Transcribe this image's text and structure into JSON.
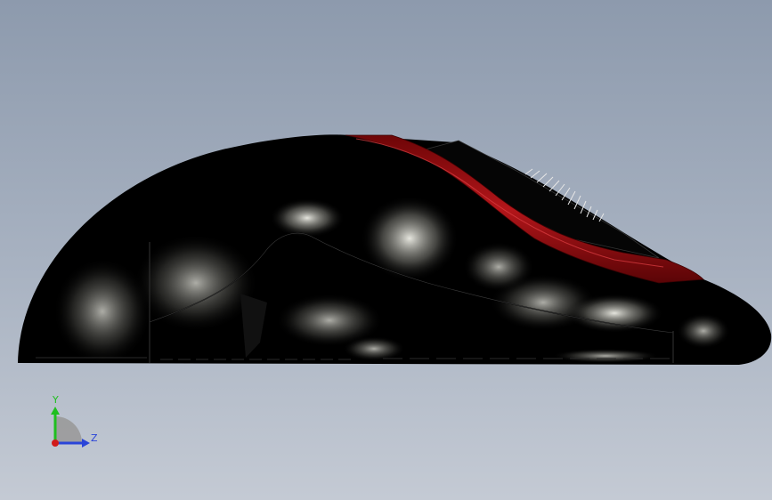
{
  "viewport": {
    "background_top": "#8d9aad",
    "background_bottom": "#c4cad4"
  },
  "model": {
    "body_color": "#000000",
    "accent_color": "#a40f12",
    "highlight_color": "#e8e8e0"
  },
  "triad": {
    "y_label": "Y",
    "z_label": "Z",
    "y_color": "#1fbf1f",
    "z_color": "#2a44d8",
    "origin_color": "#d11a1a"
  }
}
